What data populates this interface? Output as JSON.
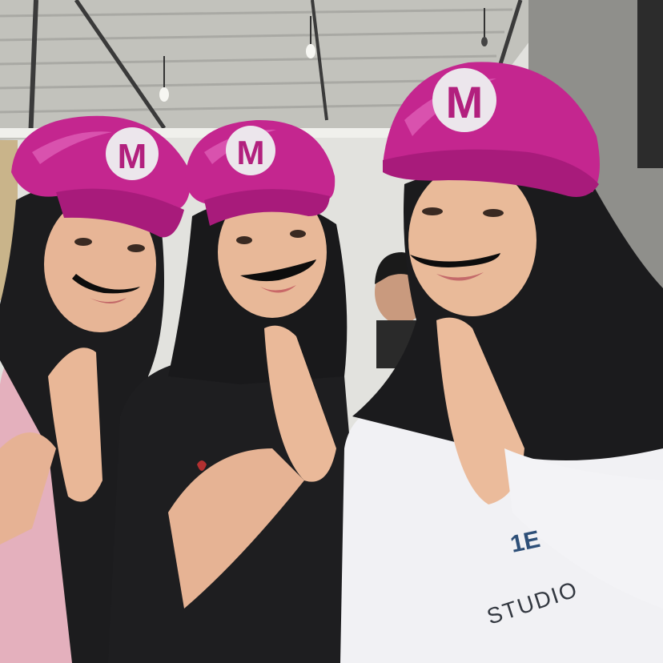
{
  "photo": {
    "cap_emblem_letter": "M",
    "shirt_print_text": "STUDIO",
    "shirt_print_partial": "1E",
    "colors": {
      "cap": "#c4268f",
      "cap_highlight": "#e05bb5",
      "cap_shadow": "#8e1566",
      "emblem_bg": "#ece6ec",
      "emblem_letter": "#b2207e",
      "hijab": "#1c1c1e",
      "skin": "#e8b998",
      "ceiling": "#bdbdb8",
      "wall": "#e4e4e0",
      "right_wall": "#9a9a96",
      "pink_shirt": "#e7b3bf",
      "white_sweater": "#f1f1f4",
      "mustache": "#0d0d0d"
    }
  }
}
